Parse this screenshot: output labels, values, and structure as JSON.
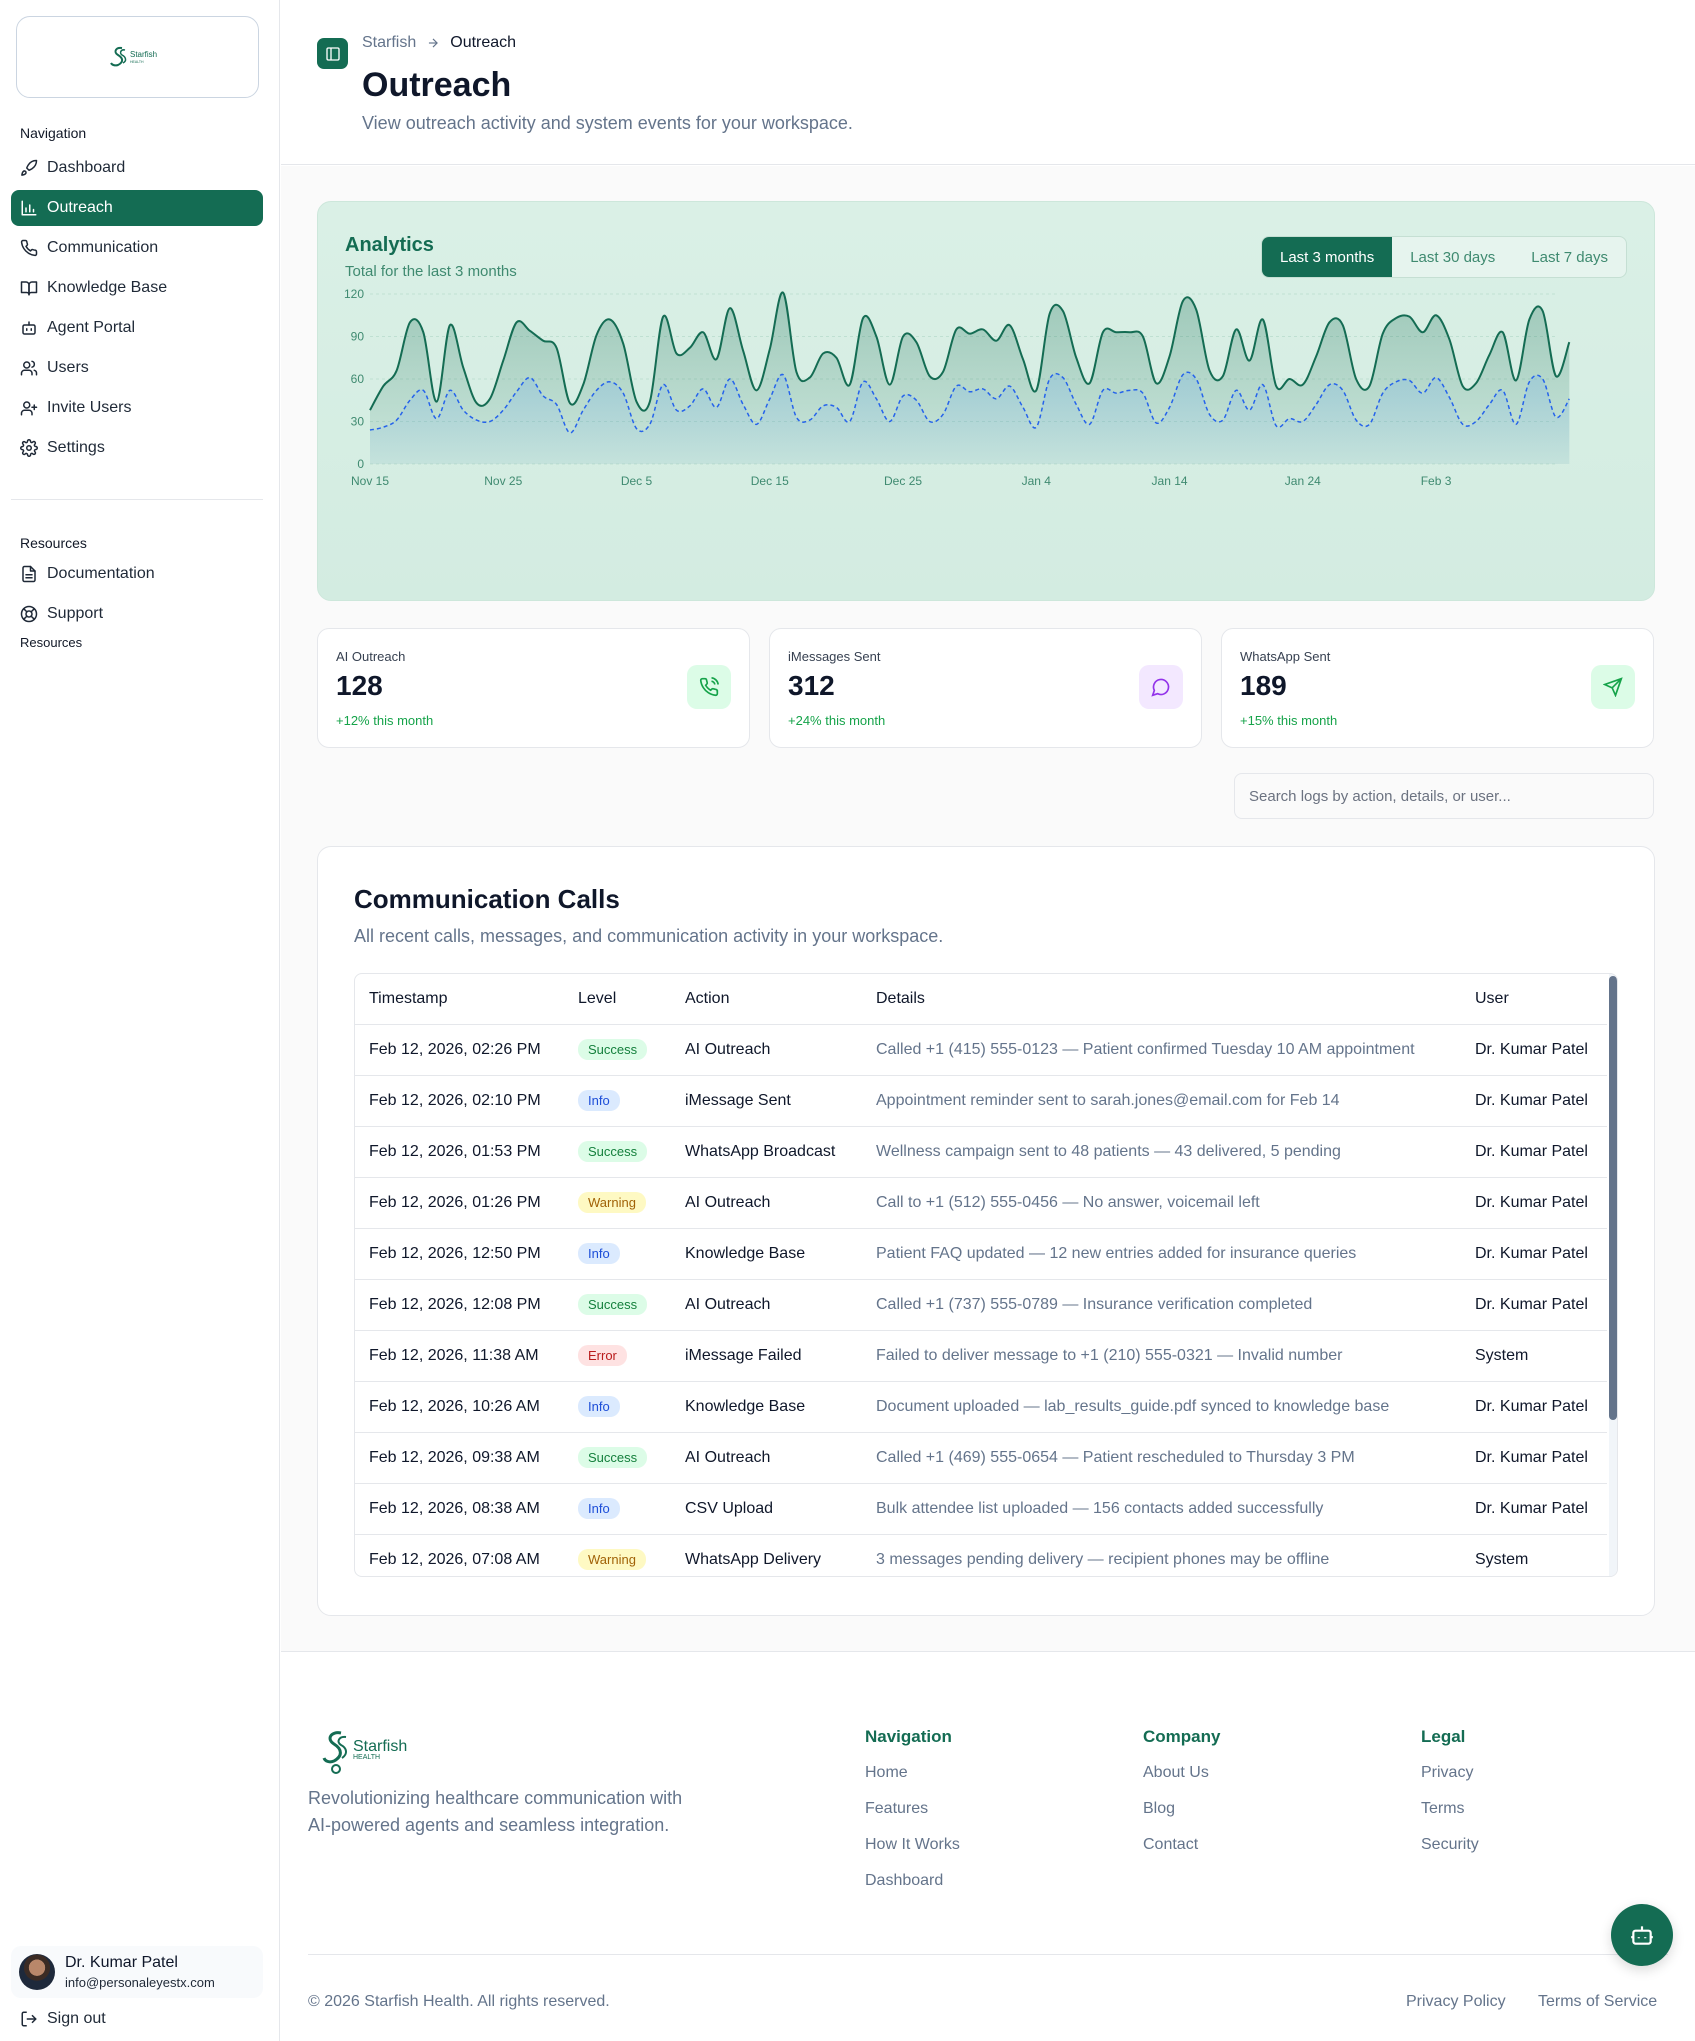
{
  "brand": {
    "name": "Starfish",
    "tagline": "HEALTH",
    "accent": "#146c53"
  },
  "sidebar": {
    "section_navigation": "Navigation",
    "nav": [
      {
        "label": "Dashboard",
        "icon": "rocket-icon",
        "active": false
      },
      {
        "label": "Outreach",
        "icon": "bar-chart-icon",
        "active": true
      },
      {
        "label": "Communication",
        "icon": "phone-icon",
        "active": false
      },
      {
        "label": "Knowledge Base",
        "icon": "book-icon",
        "active": false
      },
      {
        "label": "Agent Portal",
        "icon": "bot-icon",
        "active": false
      },
      {
        "label": "Users",
        "icon": "users-icon",
        "active": false
      },
      {
        "label": "Invite Users",
        "icon": "user-plus-icon",
        "active": false
      },
      {
        "label": "Settings",
        "icon": "gear-icon",
        "active": false
      }
    ],
    "section_resources": "Resources",
    "resources": [
      {
        "label": "Documentation",
        "icon": "document-icon"
      },
      {
        "label": "Support",
        "icon": "lifebuoy-icon"
      }
    ],
    "section_resources_repeat": "Resources",
    "user": {
      "name": "Dr. Kumar Patel",
      "email": "info@personaleyestx.com"
    },
    "signout": "Sign out"
  },
  "header": {
    "breadcrumb": [
      "Starfish",
      "Outreach"
    ],
    "title": "Outreach",
    "subtitle": "View outreach activity and system events for your workspace."
  },
  "analytics": {
    "title": "Analytics",
    "subtitle": "Total for the last 3 months",
    "ranges": [
      "Last 3 months",
      "Last 30 days",
      "Last 7 days"
    ],
    "active_range": "Last 3 months"
  },
  "chart_data": {
    "type": "area",
    "title": "",
    "xlabel": "",
    "ylabel": "",
    "ylim": [
      0,
      120
    ],
    "yticks": [
      0,
      30,
      60,
      90,
      120
    ],
    "x_tick_labels": [
      "Nov 15",
      "Nov 25",
      "Dec 5",
      "Dec 15",
      "Dec 25",
      "Jan 4",
      "Jan 14",
      "Jan 24",
      "Feb 3"
    ],
    "x": [
      "Nov 15",
      "Nov 16",
      "Nov 17",
      "Nov 18",
      "Nov 19",
      "Nov 20",
      "Nov 21",
      "Nov 22",
      "Nov 23",
      "Nov 24",
      "Nov 25",
      "Nov 26",
      "Nov 27",
      "Nov 28",
      "Nov 29",
      "Nov 30",
      "Dec 1",
      "Dec 2",
      "Dec 3",
      "Dec 4",
      "Dec 5",
      "Dec 6",
      "Dec 7",
      "Dec 8",
      "Dec 9",
      "Dec 10",
      "Dec 11",
      "Dec 12",
      "Dec 13",
      "Dec 14",
      "Dec 15",
      "Dec 16",
      "Dec 17",
      "Dec 18",
      "Dec 19",
      "Dec 20",
      "Dec 21",
      "Dec 22",
      "Dec 23",
      "Dec 24",
      "Dec 25",
      "Dec 26",
      "Dec 27",
      "Dec 28",
      "Dec 29",
      "Dec 30",
      "Dec 31",
      "Jan 1",
      "Jan 2",
      "Jan 3",
      "Jan 4",
      "Jan 5",
      "Jan 6",
      "Jan 7",
      "Jan 8",
      "Jan 9",
      "Jan 10",
      "Jan 11",
      "Jan 12",
      "Jan 13",
      "Jan 14",
      "Jan 15",
      "Jan 16",
      "Jan 17",
      "Jan 18",
      "Jan 19",
      "Jan 20",
      "Jan 21",
      "Jan 22",
      "Jan 23",
      "Jan 24",
      "Jan 25",
      "Jan 26",
      "Jan 27",
      "Jan 28",
      "Jan 29",
      "Jan 30",
      "Jan 31",
      "Feb 1",
      "Feb 2",
      "Feb 3",
      "Feb 4",
      "Feb 5",
      "Feb 6",
      "Feb 7",
      "Feb 8",
      "Feb 9",
      "Feb 10",
      "Feb 11",
      "Feb 12"
    ],
    "series": [
      {
        "color": "#146c53",
        "style": "solid",
        "fill": true,
        "values": [
          38,
          55,
          66,
          100,
          93,
          44,
          98,
          68,
          43,
          46,
          73,
          100,
          94,
          87,
          82,
          43,
          56,
          91,
          102,
          85,
          44,
          44,
          104,
          78,
          82,
          93,
          74,
          110,
          80,
          52,
          81,
          121,
          65,
          61,
          78,
          75,
          56,
          103,
          90,
          56,
          90,
          86,
          62,
          65,
          95,
          92,
          95,
          87,
          98,
          74,
          52,
          106,
          108,
          75,
          57,
          93,
          93,
          93,
          90,
          57,
          76,
          115,
          109,
          66,
          62,
          95,
          73,
          102,
          55,
          60,
          56,
          76,
          100,
          98,
          60,
          55,
          92,
          103,
          104,
          93,
          105,
          88,
          55,
          57,
          77,
          93,
          59,
          102,
          108,
          62,
          86
        ]
      },
      {
        "color": "#2563eb",
        "style": "dashed",
        "fill": true,
        "values": [
          24,
          26,
          31,
          45,
          52,
          32,
          52,
          38,
          31,
          30,
          38,
          51,
          61,
          48,
          42,
          22,
          38,
          52,
          58,
          50,
          25,
          28,
          56,
          38,
          41,
          53,
          40,
          60,
          42,
          28,
          46,
          63,
          33,
          31,
          41,
          40,
          30,
          58,
          46,
          30,
          48,
          45,
          30,
          35,
          55,
          51,
          53,
          46,
          55,
          40,
          26,
          60,
          61,
          42,
          28,
          52,
          50,
          52,
          50,
          29,
          40,
          63,
          60,
          35,
          31,
          52,
          38,
          56,
          27,
          32,
          30,
          42,
          56,
          52,
          31,
          28,
          50,
          58,
          59,
          50,
          61,
          47,
          28,
          30,
          42,
          52,
          28,
          58,
          60,
          33,
          46
        ]
      }
    ]
  },
  "stats": [
    {
      "label": "AI Outreach",
      "value": "128",
      "change": "+12% this month",
      "icon": "phone-icon",
      "icon_bg": "#dcfce7",
      "icon_color": "#16a34a"
    },
    {
      "label": "iMessages Sent",
      "value": "312",
      "change": "+24% this month",
      "icon": "message-circle-icon",
      "icon_bg": "#f3e8ff",
      "icon_color": "#9333ea"
    },
    {
      "label": "WhatsApp Sent",
      "value": "189",
      "change": "+15% this month",
      "icon": "send-icon",
      "icon_bg": "#dcfce7",
      "icon_color": "#16a34a"
    }
  ],
  "search": {
    "placeholder": "Search logs by action, details, or user..."
  },
  "calls": {
    "title": "Communication Calls",
    "subtitle": "All recent calls, messages, and communication activity in your workspace.",
    "columns": [
      "Timestamp",
      "Level",
      "Action",
      "Details",
      "User"
    ],
    "rows": [
      {
        "timestamp": "Feb 12, 2026, 02:26 PM",
        "level": "Success",
        "action": "AI Outreach",
        "details": "Called +1 (415) 555-0123 — Patient confirmed Tuesday 10 AM appointment",
        "user": "Dr. Kumar Patel"
      },
      {
        "timestamp": "Feb 12, 2026, 02:10 PM",
        "level": "Info",
        "action": "iMessage Sent",
        "details": "Appointment reminder sent to sarah.jones@email.com for Feb 14",
        "user": "Dr. Kumar Patel"
      },
      {
        "timestamp": "Feb 12, 2026, 01:53 PM",
        "level": "Success",
        "action": "WhatsApp Broadcast",
        "details": "Wellness campaign sent to 48 patients — 43 delivered, 5 pending",
        "user": "Dr. Kumar Patel"
      },
      {
        "timestamp": "Feb 12, 2026, 01:26 PM",
        "level": "Warning",
        "action": "AI Outreach",
        "details": "Call to +1 (512) 555-0456 — No answer, voicemail left",
        "user": "Dr. Kumar Patel"
      },
      {
        "timestamp": "Feb 12, 2026, 12:50 PM",
        "level": "Info",
        "action": "Knowledge Base",
        "details": "Patient FAQ updated — 12 new entries added for insurance queries",
        "user": "Dr. Kumar Patel"
      },
      {
        "timestamp": "Feb 12, 2026, 12:08 PM",
        "level": "Success",
        "action": "AI Outreach",
        "details": "Called +1 (737) 555-0789 — Insurance verification completed",
        "user": "Dr. Kumar Patel"
      },
      {
        "timestamp": "Feb 12, 2026, 11:38 AM",
        "level": "Error",
        "action": "iMessage Failed",
        "details": "Failed to deliver message to +1 (210) 555-0321 — Invalid number",
        "user": "System"
      },
      {
        "timestamp": "Feb 12, 2026, 10:26 AM",
        "level": "Info",
        "action": "Knowledge Base",
        "details": "Document uploaded — lab_results_guide.pdf synced to knowledge base",
        "user": "Dr. Kumar Patel"
      },
      {
        "timestamp": "Feb 12, 2026, 09:38 AM",
        "level": "Success",
        "action": "AI Outreach",
        "details": "Called +1 (469) 555-0654 — Patient rescheduled to Thursday 3 PM",
        "user": "Dr. Kumar Patel"
      },
      {
        "timestamp": "Feb 12, 2026, 08:38 AM",
        "level": "Info",
        "action": "CSV Upload",
        "details": "Bulk attendee list uploaded — 156 contacts added successfully",
        "user": "Dr. Kumar Patel"
      },
      {
        "timestamp": "Feb 12, 2026, 07:08 AM",
        "level": "Warning",
        "action": "WhatsApp Delivery",
        "details": "3 messages pending delivery — recipient phones may be offline",
        "user": "System"
      }
    ]
  },
  "footer": {
    "description": "Revolutionizing healthcare communication with AI-powered agents and seamless integration.",
    "columns": [
      {
        "title": "Navigation",
        "links": [
          "Home",
          "Features",
          "How It Works",
          "Dashboard"
        ]
      },
      {
        "title": "Company",
        "links": [
          "About Us",
          "Blog",
          "Contact"
        ]
      },
      {
        "title": "Legal",
        "links": [
          "Privacy",
          "Terms",
          "Security"
        ]
      }
    ],
    "copyright": "© 2026 Starfish Health. All rights reserved.",
    "bottom_links": [
      "Privacy Policy",
      "Terms of Service"
    ]
  }
}
